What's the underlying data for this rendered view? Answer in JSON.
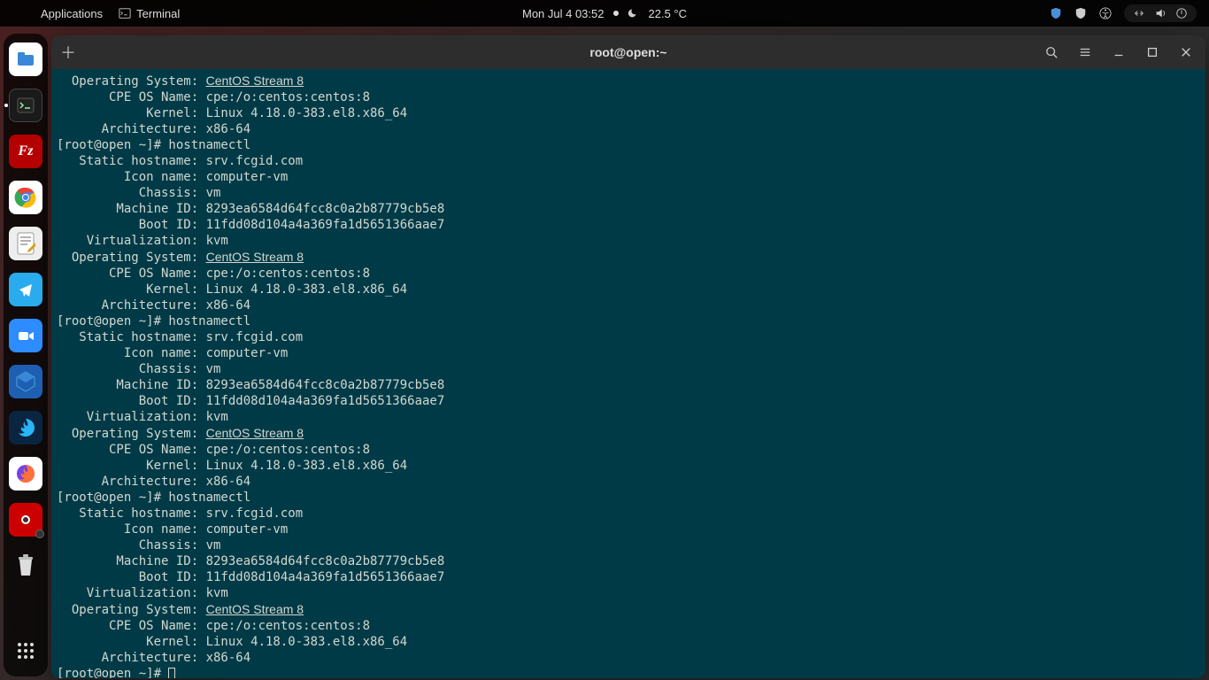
{
  "topbar": {
    "applications": "Applications",
    "terminal": "Terminal",
    "clock": "Mon Jul 4  03:52",
    "temp": "22.5 °C"
  },
  "window": {
    "title": "root@open:~"
  },
  "dock": {
    "items": [
      {
        "name": "files"
      },
      {
        "name": "terminal"
      },
      {
        "name": "filezilla"
      },
      {
        "name": "chrome"
      },
      {
        "name": "text-editor"
      },
      {
        "name": "telegram"
      },
      {
        "name": "zoom"
      },
      {
        "name": "virtualbox"
      },
      {
        "name": "firefox-dev"
      },
      {
        "name": "firefox"
      },
      {
        "name": "cheese"
      },
      {
        "name": "trash"
      }
    ]
  },
  "terminal": {
    "prompt_host": "[root@open ~]#",
    "command": "hostnamectl",
    "fields": {
      "static_hostname_label": "   Static hostname:",
      "static_hostname": "srv.fcgid.com",
      "icon_name_label": "         Icon name:",
      "icon_name": "computer-vm",
      "chassis_label": "           Chassis:",
      "chassis": "vm",
      "machine_id_label": "        Machine ID:",
      "machine_id": "8293ea6584d64fcc8c0a2b87779cb5e8",
      "boot_id_label": "           Boot ID:",
      "boot_id": "11fdd08d104a4a369fa1d5651366aae7",
      "virt_label": "    Virtualization:",
      "virt": "kvm",
      "os_label": "  Operating System:",
      "os": "CentOS Stream 8",
      "cpe_label": "       CPE OS Name:",
      "cpe": "cpe:/o:centos:centos:8",
      "kernel_label": "            Kernel:",
      "kernel": "Linux 4.18.0-383.el8.x86_64",
      "arch_label": "      Architecture:",
      "arch": "x86-64"
    }
  }
}
